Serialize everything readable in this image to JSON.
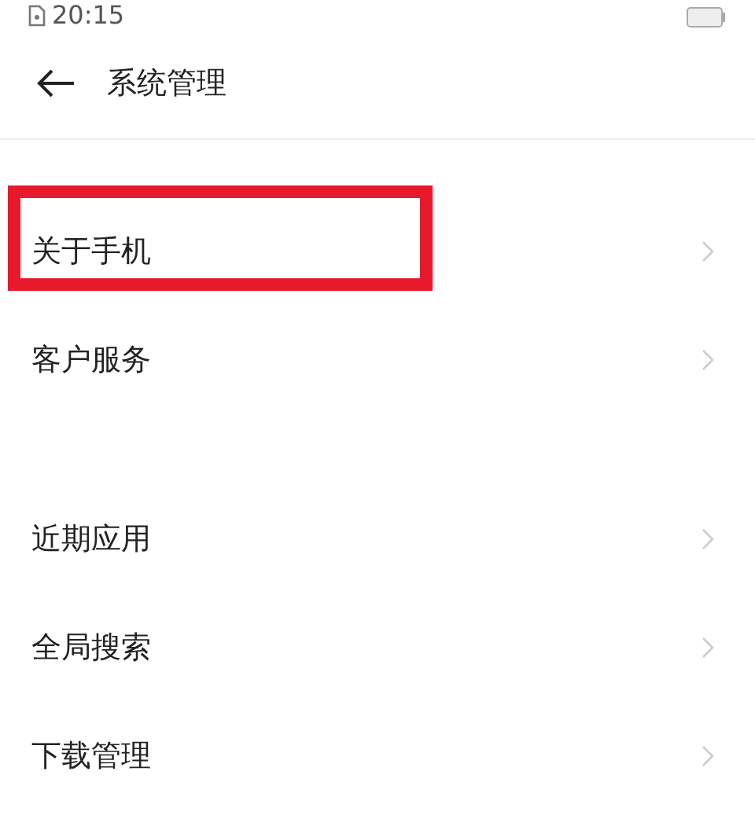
{
  "status_bar": {
    "time": "20:15"
  },
  "header": {
    "title": "系统管理"
  },
  "groups": [
    {
      "items": [
        {
          "label": "关于手机",
          "highlighted": true
        },
        {
          "label": "客户服务",
          "highlighted": false
        }
      ]
    },
    {
      "items": [
        {
          "label": "近期应用",
          "highlighted": false
        },
        {
          "label": "全局搜索",
          "highlighted": false
        },
        {
          "label": "下载管理",
          "highlighted": false
        }
      ]
    }
  ]
}
